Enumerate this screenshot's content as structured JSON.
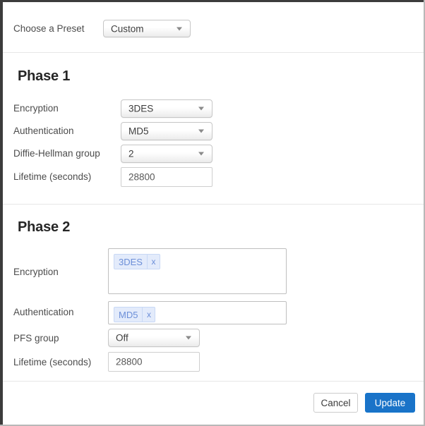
{
  "preset": {
    "label": "Choose a Preset",
    "select": {
      "name": "preset-select",
      "value": "Custom",
      "options": [
        "Custom"
      ]
    }
  },
  "phase1": {
    "heading": "Phase 1",
    "fields": {
      "encryption": {
        "label": "Encryption",
        "value": "3DES"
      },
      "authentication": {
        "label": "Authentication",
        "value": "MD5"
      },
      "dh_group": {
        "label": "Diffie-Hellman group",
        "value": "2"
      },
      "lifetime": {
        "label": "Lifetime (seconds)",
        "value": "28800"
      }
    }
  },
  "phase2": {
    "heading": "Phase 2",
    "fields": {
      "encryption": {
        "label": "Encryption",
        "tags": [
          {
            "label": "3DES",
            "remove": "x"
          }
        ]
      },
      "authentication": {
        "label": "Authentication",
        "tags": [
          {
            "label": "MD5",
            "remove": "x"
          }
        ]
      },
      "pfs_group": {
        "label": "PFS group",
        "value": "Off"
      },
      "lifetime": {
        "label": "Lifetime (seconds)",
        "value": "28800"
      }
    }
  },
  "footer": {
    "cancel_label": "Cancel",
    "update_label": "Update"
  },
  "colors": {
    "primary": "#1a73c8",
    "tag_bg": "#e3ebfb",
    "tag_text": "#6c8fd8",
    "divider": "#e7e7e7",
    "label_text": "#4c4c4c",
    "heading_text": "#262626"
  }
}
